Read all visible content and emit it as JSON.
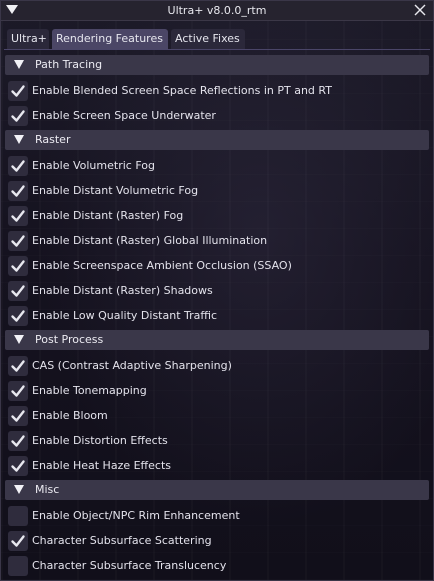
{
  "window": {
    "title": "Ultra+ v8.0.0_rtm"
  },
  "tabs": [
    {
      "label": "Ultra+",
      "active": false
    },
    {
      "label": "Rendering Features",
      "active": true
    },
    {
      "label": "Active Fixes",
      "active": false
    }
  ],
  "sections": [
    {
      "label": "Path Tracing",
      "items": [
        {
          "label": "Enable Blended Screen Space Reflections in PT and RT",
          "checked": true
        },
        {
          "label": "Enable Screen Space Underwater",
          "checked": true
        }
      ]
    },
    {
      "label": "Raster",
      "items": [
        {
          "label": "Enable Volumetric Fog",
          "checked": true
        },
        {
          "label": "Enable Distant Volumetric Fog",
          "checked": true
        },
        {
          "label": "Enable Distant (Raster) Fog",
          "checked": true
        },
        {
          "label": "Enable Distant (Raster) Global Illumination",
          "checked": true
        },
        {
          "label": "Enable Screenspace Ambient Occlusion (SSAO)",
          "checked": true
        },
        {
          "label": "Enable Distant (Raster) Shadows",
          "checked": true
        },
        {
          "label": "Enable Low Quality Distant Traffic",
          "checked": true
        }
      ]
    },
    {
      "label": "Post Process",
      "items": [
        {
          "label": "CAS (Contrast Adaptive Sharpening)",
          "checked": true
        },
        {
          "label": "Enable Tonemapping",
          "checked": true
        },
        {
          "label": "Enable Bloom",
          "checked": true
        },
        {
          "label": "Enable Distortion Effects",
          "checked": true
        },
        {
          "label": "Enable Heat Haze Effects",
          "checked": true
        }
      ]
    },
    {
      "label": "Misc",
      "items": [
        {
          "label": "Enable Object/NPC Rim Enhancement",
          "checked": false
        },
        {
          "label": "Character Subsurface Scattering",
          "checked": true
        },
        {
          "label": "Character Subsurface Translucency",
          "checked": false
        }
      ]
    }
  ],
  "colors": {
    "accent": "#4b4666",
    "section_bg": "#3a3749",
    "checkbox_bg": "#2f2c3d",
    "check_mark": "#e8e8ef"
  }
}
